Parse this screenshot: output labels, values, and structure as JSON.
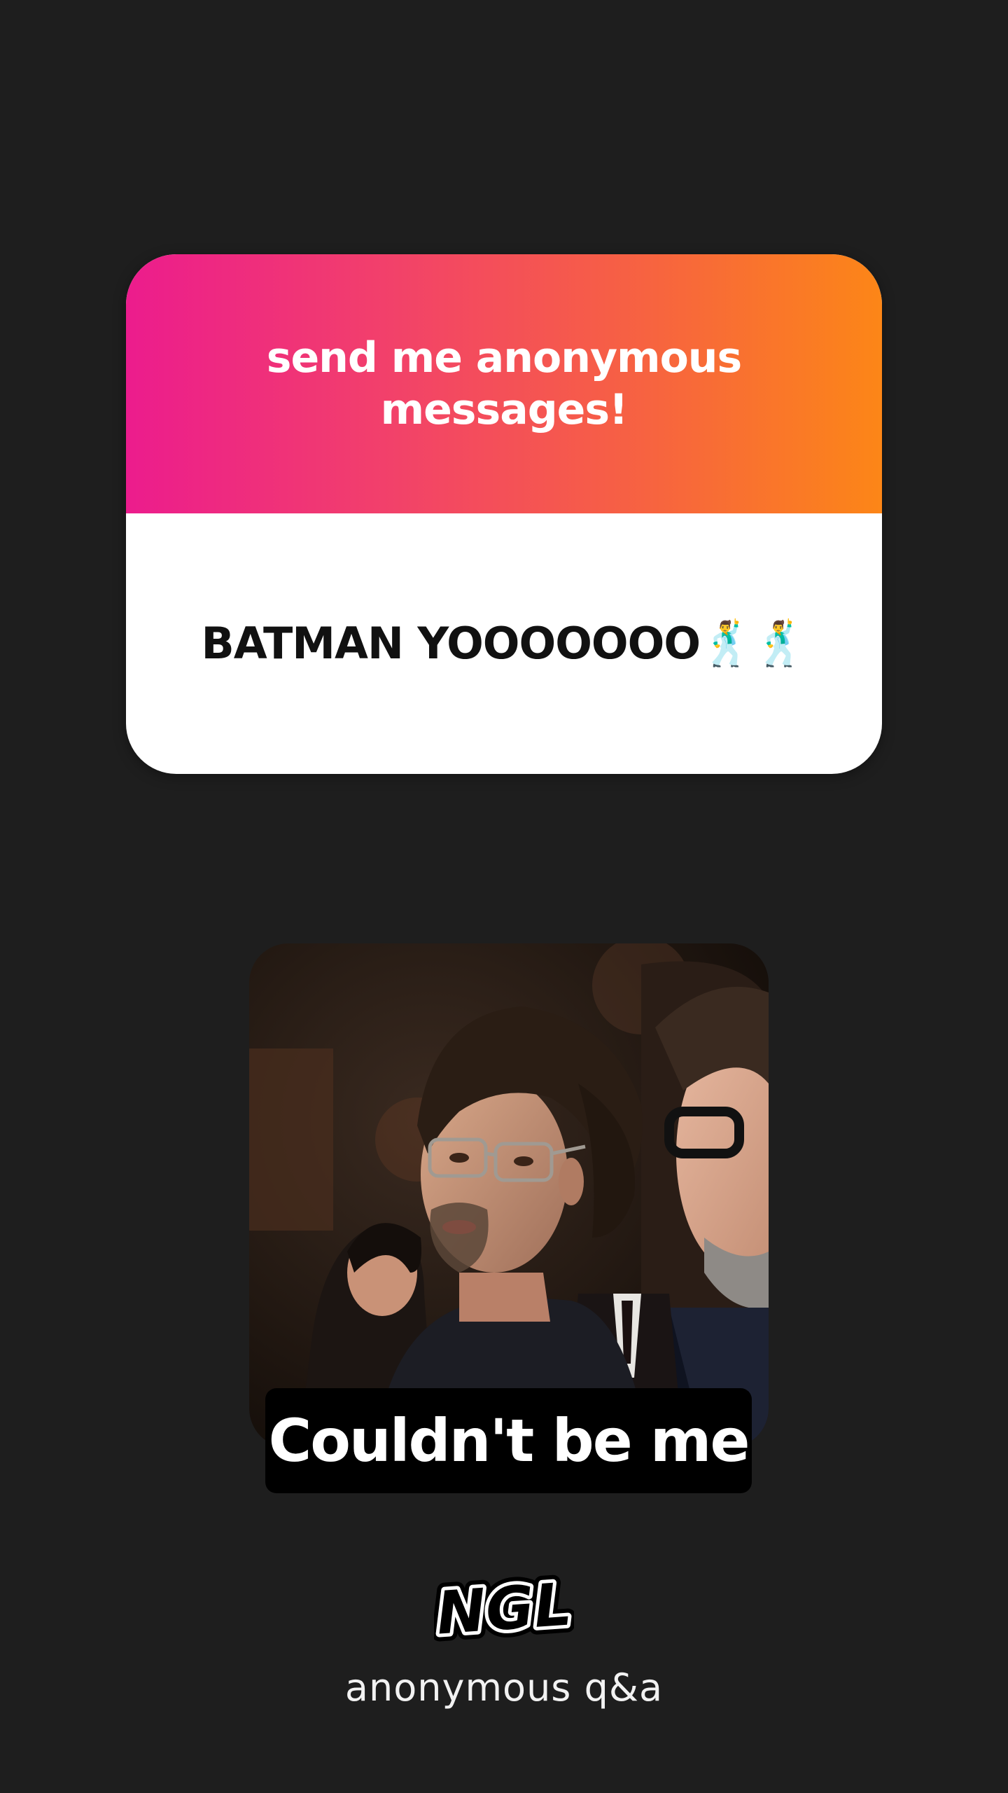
{
  "card": {
    "prompt": "send me anonymous messages!",
    "answer": "BATMAN YOOOOOOO🕺🕺",
    "gradient_start": "#ec1c8d",
    "gradient_end": "#fc8617"
  },
  "reply": {
    "caption": "Couldn't be me"
  },
  "brand": {
    "logo_text": "NGL",
    "tagline": "anonymous q&a"
  }
}
